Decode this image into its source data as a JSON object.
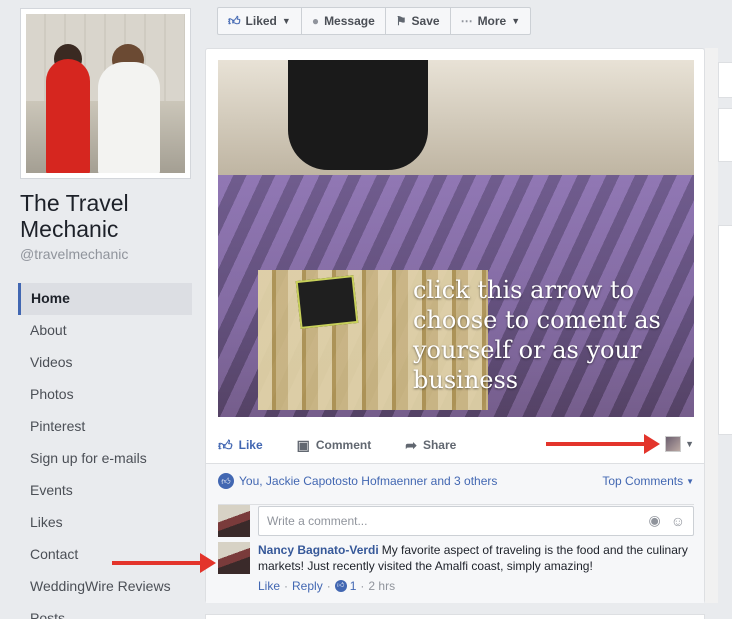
{
  "page": {
    "name": "The Travel Mechanic",
    "handle": "@travelmechanic"
  },
  "nav": {
    "items": [
      {
        "label": "Home",
        "active": true
      },
      {
        "label": "About"
      },
      {
        "label": "Videos"
      },
      {
        "label": "Photos"
      },
      {
        "label": "Pinterest"
      },
      {
        "label": "Sign up for e-mails"
      },
      {
        "label": "Events"
      },
      {
        "label": "Likes"
      },
      {
        "label": "Contact"
      },
      {
        "label": "WeddingWire Reviews"
      },
      {
        "label": "Posts"
      }
    ]
  },
  "action_bar": {
    "liked": "Liked",
    "message": "Message",
    "save": "Save",
    "more": "More"
  },
  "post": {
    "overlay_text": "click this arrow to choose to coment as yourself or as your business",
    "actions": {
      "like": "Like",
      "comment": "Comment",
      "share": "Share"
    },
    "reactions_summary": "You, Jackie Capotosto Hofmaenner and 3 others",
    "sort_label": "Top Comments",
    "comment_placeholder": "Write a comment...",
    "comments": [
      {
        "author": "Nancy Bagnato-Verdi",
        "text": "My favorite aspect of traveling is the food and the culinary markets! Just recently visited the Amalfi coast, simply amazing!",
        "like": "Like",
        "reply": "Reply",
        "likes_count": "1",
        "time": "2 hrs"
      }
    ]
  },
  "icons": {
    "liked": "thumbs-up-icon",
    "message": "message-bubble-icon",
    "save": "bookmark-icon",
    "more": "ellipsis-icon",
    "camera": "camera-icon",
    "emoji": "emoji-icon"
  },
  "colors": {
    "brand": "#4267b2",
    "link": "#365899",
    "arrow": "#e3342b",
    "background": "#e9ebee"
  }
}
